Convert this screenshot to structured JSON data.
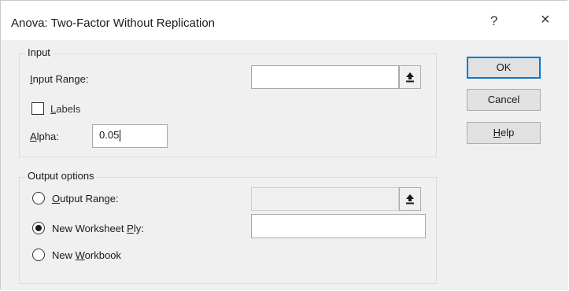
{
  "window": {
    "title": "Anova: Two-Factor Without Replication",
    "help_glyph": "?",
    "close_glyph": "×"
  },
  "input_group": {
    "legend": "Input",
    "input_range": {
      "label_key": "I",
      "label_rest": "nput Range:",
      "value": ""
    },
    "labels_checkbox": {
      "label_key": "L",
      "label_rest": "abels",
      "checked": false
    },
    "alpha": {
      "label_key": "A",
      "label_rest": "lpha:",
      "value": "0.05"
    }
  },
  "output_group": {
    "legend": "Output options",
    "output_range": {
      "label_key": "O",
      "label_rest": "utput Range:",
      "selected": false,
      "value": ""
    },
    "new_worksheet": {
      "label_pre": "New Worksheet ",
      "label_key": "P",
      "label_rest": "ly:",
      "selected": true,
      "value": ""
    },
    "new_workbook": {
      "label_pre": "New ",
      "label_key": "W",
      "label_rest": "orkbook",
      "selected": false
    }
  },
  "buttons": {
    "ok": "OK",
    "cancel": "Cancel",
    "help_key": "H",
    "help_rest": "elp"
  },
  "icons": {
    "range_select": "upload-arrow-icon",
    "checkbox": "checkbox-icon",
    "radio": "radio-icon"
  },
  "colors": {
    "dialog_bg": "#f0f0f0",
    "title_bg": "#ffffff",
    "default_button_border": "#0078d7"
  }
}
